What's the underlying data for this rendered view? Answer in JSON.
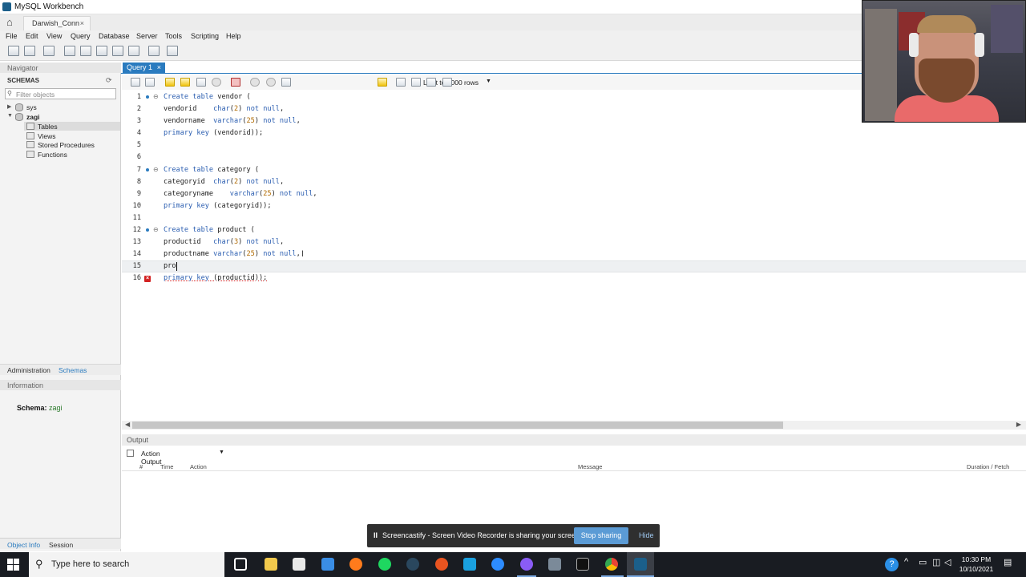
{
  "window": {
    "title": "MySQL Workbench",
    "connection_tab": "Darwish_Conn",
    "close_glyph": "×"
  },
  "menu": [
    "File",
    "Edit",
    "View",
    "Query",
    "Database",
    "Server",
    "Tools",
    "Scripting",
    "Help"
  ],
  "navigator": {
    "header": "Navigator",
    "schemas_label": "SCHEMAS",
    "filter_placeholder": "Filter objects",
    "tree": {
      "sys": "sys",
      "zagi": "zagi",
      "children": [
        "Tables",
        "Views",
        "Stored Procedures",
        "Functions"
      ]
    },
    "tabs": {
      "administration": "Administration",
      "schemas": "Schemas"
    },
    "information_header": "Information",
    "schema_label": "Schema:",
    "schema_value": "zagi",
    "bottom_tabs": {
      "object_info": "Object Info",
      "session": "Session"
    }
  },
  "editor": {
    "tab_label": "Query 1",
    "limit_label": "Limit to 1000 rows",
    "lines": {
      "l1": {
        "n": "1",
        "a": "Create table",
        "b": " vendor ("
      },
      "l2": {
        "n": "2",
        "a": "vendorid    ",
        "t": "char",
        "p1": "(",
        "num": "2",
        "p2": ") ",
        "k": "not null",
        "e": ","
      },
      "l3": {
        "n": "3",
        "a": "vendorname  ",
        "t": "varchar",
        "p1": "(",
        "num": "25",
        "p2": ") ",
        "k": "not null",
        "e": ","
      },
      "l4": {
        "n": "4",
        "k": "primary key",
        "e": " (vendorid));"
      },
      "l5": {
        "n": "5"
      },
      "l6": {
        "n": "6"
      },
      "l7": {
        "n": "7",
        "a": "Create table",
        "b": " category ("
      },
      "l8": {
        "n": "8",
        "a": "categoryid  ",
        "t": "char",
        "p1": "(",
        "num": "2",
        "p2": ") ",
        "k": "not null",
        "e": ","
      },
      "l9": {
        "n": "9",
        "a": "categoryname    ",
        "t": "varchar",
        "p1": "(",
        "num": "25",
        "p2": ") ",
        "k": "not null",
        "e": ","
      },
      "l10": {
        "n": "10",
        "k": "primary key",
        "e": " (categoryid));"
      },
      "l11": {
        "n": "11"
      },
      "l12": {
        "n": "12",
        "a": "Create table",
        "b": " product ("
      },
      "l13": {
        "n": "13",
        "a": "productid   ",
        "t": "char",
        "p1": "(",
        "num": "3",
        "p2": ") ",
        "k": "not null",
        "e": ","
      },
      "l14": {
        "n": "14",
        "a": "productname ",
        "t": "varchar",
        "p1": "(",
        "num": "25",
        "p2": ") ",
        "k": "not null",
        "e": ","
      },
      "l15": {
        "n": "15",
        "a": "pro"
      },
      "l16": {
        "n": "16",
        "k": "primary key",
        "e": " (productid));"
      }
    }
  },
  "output": {
    "header": "Output",
    "selector": "Action Output",
    "columns": [
      "#",
      "Time",
      "Action",
      "Message",
      "Duration / Fetch"
    ]
  },
  "share_bar": {
    "pause_glyph": "II",
    "message": "Screencastify - Screen Video Recorder is sharing your screen.",
    "stop_label": "Stop sharing",
    "hide_label": "Hide"
  },
  "taskbar": {
    "search_placeholder": "Type here to search",
    "time": "10:30 PM",
    "date": "10/10/2021"
  },
  "colors": {
    "accent": "#2a7bbf",
    "keyword": "#2a5db0",
    "number": "#b06a00",
    "error": "#d32222",
    "schema_value": "#2b7a2b"
  }
}
